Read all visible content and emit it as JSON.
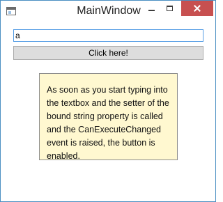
{
  "window": {
    "title": "MainWindow"
  },
  "icons": {
    "app": "window-icon",
    "minimize": "minimize-icon",
    "maximize": "maximize-icon",
    "close": "close-icon"
  },
  "form": {
    "input_value": "a",
    "button_label": "Click here!"
  },
  "note": {
    "text": "As soon as you start typing into the textbox and the setter of the bound string property is called and the CanExecuteChanged event is raised, the button is enabled."
  },
  "colors": {
    "close_button": "#c75050",
    "input_border": "#569de5",
    "note_background": "#fff8d0"
  }
}
